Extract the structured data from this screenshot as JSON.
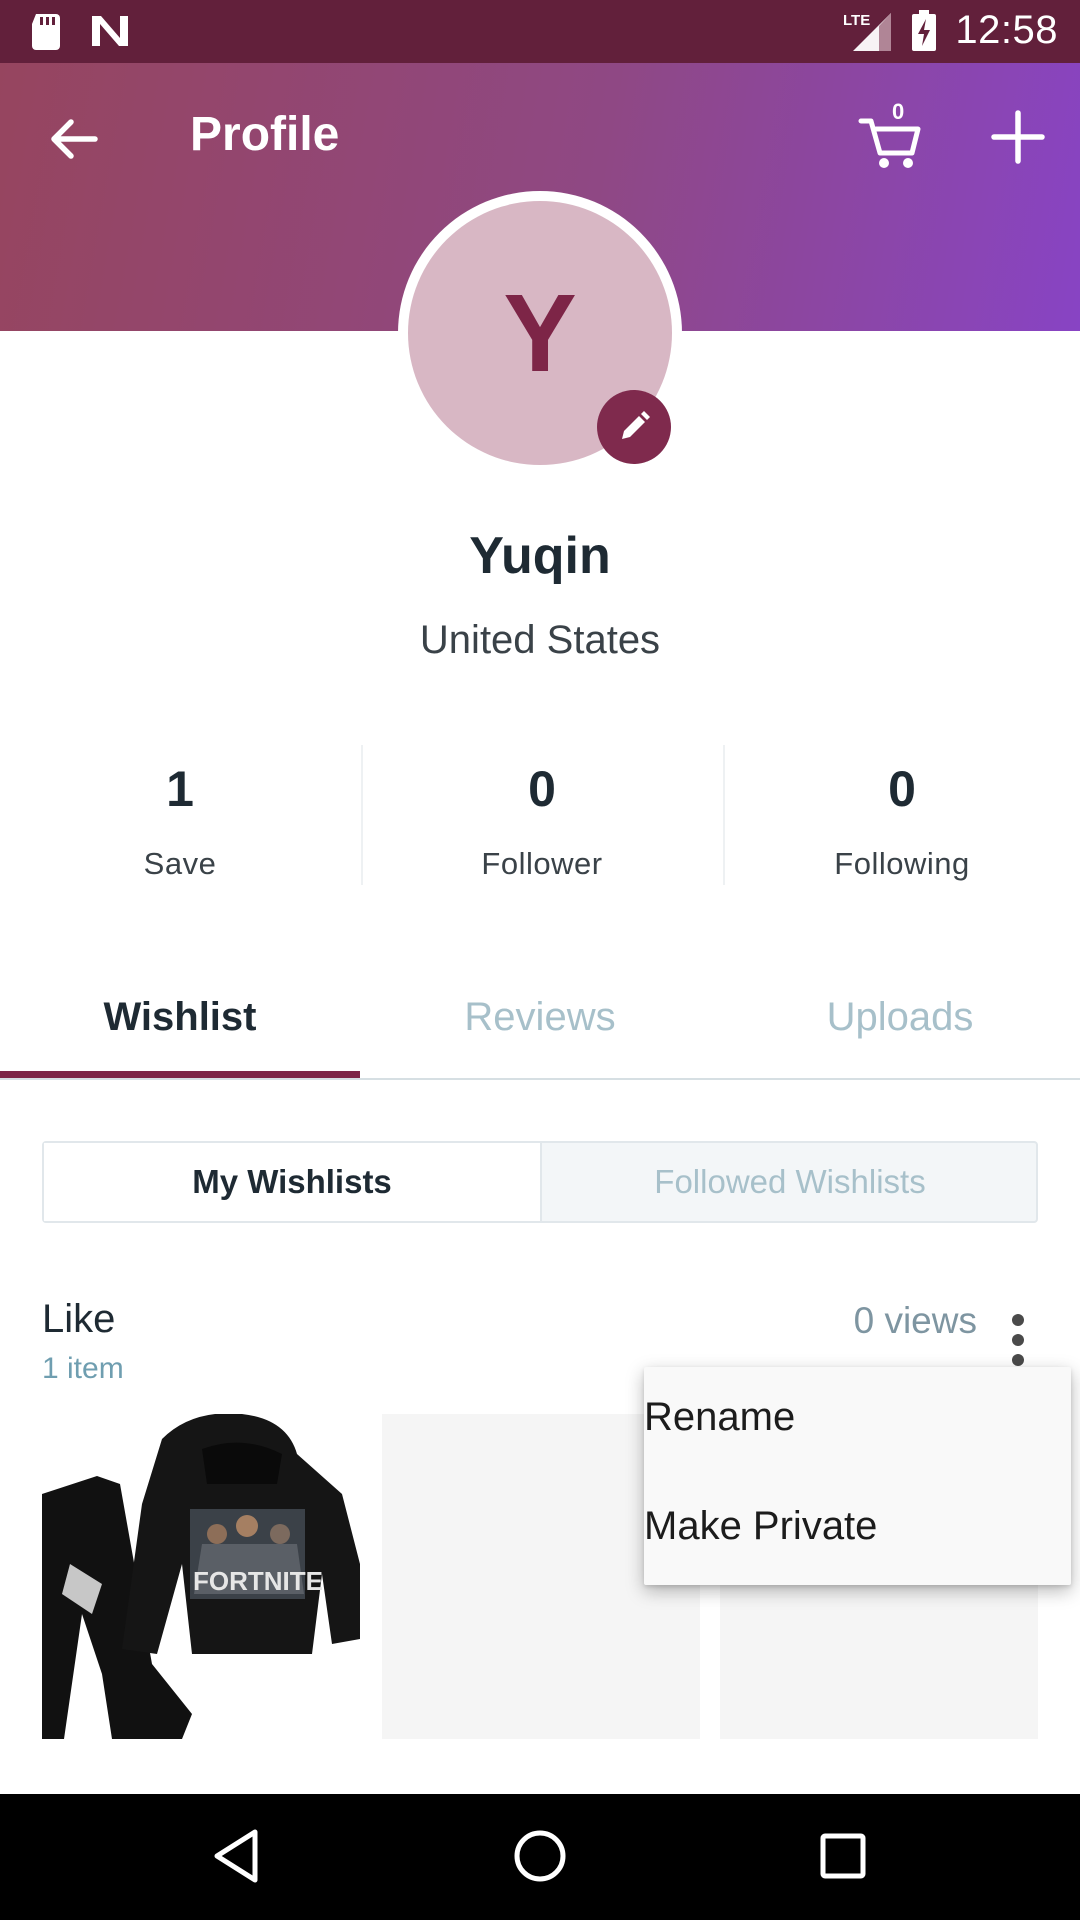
{
  "status_bar": {
    "time": "12:58",
    "network": "LTE",
    "icons": [
      "sd-card-icon",
      "n-notification-icon",
      "signal-icon",
      "battery-charging-icon"
    ]
  },
  "header": {
    "title": "Profile",
    "cart_count": "0",
    "icons": [
      "back-arrow-icon",
      "cart-icon",
      "plus-icon"
    ],
    "gradient_colors": [
      "#96455f",
      "#8844c4"
    ]
  },
  "profile": {
    "avatar_initial": "Y",
    "name": "Yuqin",
    "country": "United States",
    "avatar_color": "#d8b7c4",
    "accent_color": "#7d2547"
  },
  "stats": [
    {
      "value": "1",
      "label": "Save"
    },
    {
      "value": "0",
      "label": "Follower"
    },
    {
      "value": "0",
      "label": "Following"
    }
  ],
  "tabs": [
    {
      "label": "Wishlist",
      "active": true
    },
    {
      "label": "Reviews",
      "active": false
    },
    {
      "label": "Uploads",
      "active": false
    }
  ],
  "segments": {
    "left": "My Wishlists",
    "right": "Followed Wishlists",
    "selected": "My Wishlists"
  },
  "wishlist": {
    "title": "Like",
    "count": "1 item",
    "views": "0 views",
    "product_image": "Fortnite hoodie and pants set"
  },
  "menu": {
    "items": [
      "Rename",
      "Make Private"
    ]
  },
  "nav_bar": {
    "icons": [
      "back-triangle-icon",
      "home-circle-icon",
      "recents-square-icon"
    ]
  }
}
